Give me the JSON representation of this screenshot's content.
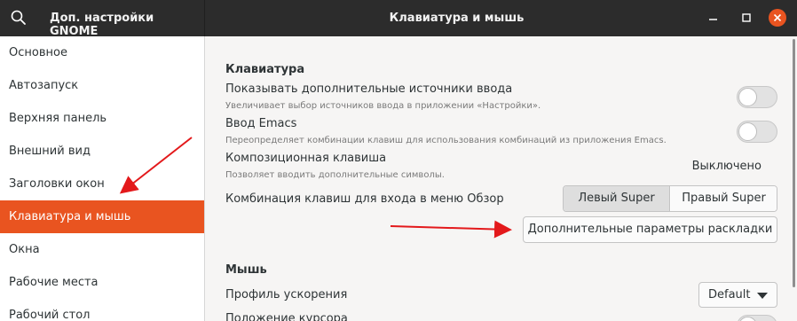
{
  "header": {
    "app_title": "Доп. настройки GNOME",
    "page_title": "Клавиатура и мышь",
    "icons": [
      "search-icon",
      "minimize-icon",
      "maximize-icon",
      "close-icon"
    ]
  },
  "sidebar": {
    "items": [
      {
        "label": "Основное"
      },
      {
        "label": "Автозапуск"
      },
      {
        "label": "Верхняя панель"
      },
      {
        "label": "Внешний вид"
      },
      {
        "label": "Заголовки окон"
      },
      {
        "label": "Клавиатура и мышь",
        "active": true
      },
      {
        "label": "Окна"
      },
      {
        "label": "Рабочие места"
      },
      {
        "label": "Рабочий стол"
      }
    ]
  },
  "keyboard": {
    "section_title": "Клавиатура",
    "extra_sources": {
      "label": "Показывать дополнительные источники ввода",
      "description": "Увеличивает выбор источников ввода в приложении «Настройки».",
      "enabled": false
    },
    "emacs": {
      "label": "Ввод Emacs",
      "description": "Переопределяет комбинации клавиш для использования комбинаций из приложения Emacs.",
      "enabled": false
    },
    "compose": {
      "label": "Композиционная клавиша",
      "description": "Позволяет вводить дополнительные символы.",
      "value": "Выключено"
    },
    "overview_shortcut": {
      "label": "Комбинация клавиш для входа в меню Обзор",
      "options": [
        "Левый Super",
        "Правый Super"
      ],
      "selected": "Левый Super"
    },
    "layout_button": "Дополнительные параметры раскладки"
  },
  "mouse": {
    "section_title": "Мышь",
    "accel_profile": {
      "label": "Профиль ускорения",
      "value": "Default"
    },
    "pointer_location": {
      "label": "Положение курсора"
    }
  },
  "colors": {
    "accent": "#e95420",
    "header_bg": "#2c2c2c",
    "annotation_arrow": "#e3191b"
  }
}
